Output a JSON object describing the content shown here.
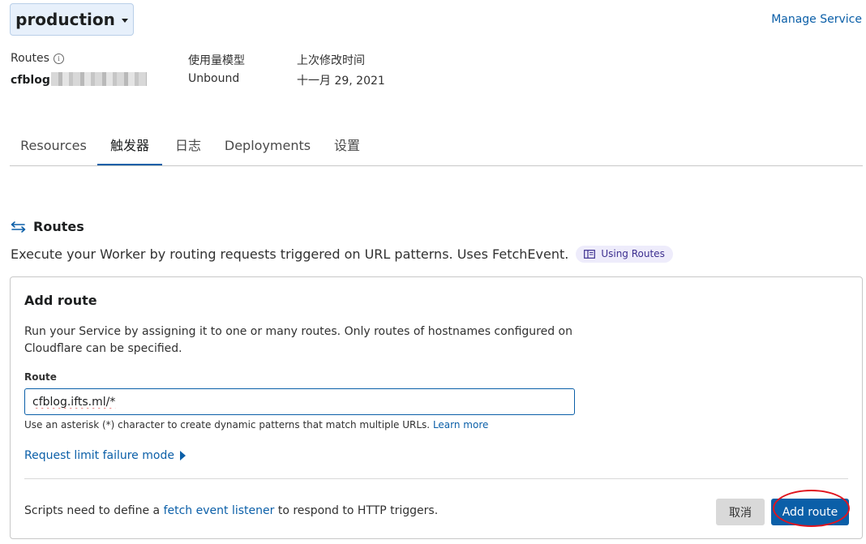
{
  "header": {
    "environment": "production",
    "manage_link": "Manage Service"
  },
  "meta": {
    "routes_label": "Routes",
    "routes_value": "cfblog",
    "usage_label": "使用量模型",
    "usage_value": "Unbound",
    "modified_label": "上次修改时间",
    "modified_value": "十一月 29, 2021"
  },
  "tabs": [
    {
      "label": "Resources"
    },
    {
      "label": "触发器",
      "active": true
    },
    {
      "label": "日志"
    },
    {
      "label": "Deployments"
    },
    {
      "label": "设置"
    }
  ],
  "routes_section": {
    "title": "Routes",
    "description": "Execute your Worker by routing requests triggered on URL patterns. Uses FetchEvent.",
    "doc_link": "Using Routes"
  },
  "add_route": {
    "title": "Add route",
    "description": "Run your Service by assigning it to one or many routes. Only routes of hostnames configured on Cloudflare can be specified.",
    "field_label": "Route",
    "input_value": "cfblog.ifts.ml/*",
    "hint": "Use an asterisk (*) character to create dynamic patterns that match multiple URLs.",
    "hint_link": "Learn more",
    "limit_toggle": "Request limit failure mode",
    "footer_prefix": "Scripts need to define a",
    "footer_link": "fetch event listener",
    "footer_suffix": "to respond to HTTP triggers.",
    "cancel_label": "取消",
    "submit_label": "Add route"
  },
  "colors": {
    "accent": "#0b5fa8",
    "env_bg": "#e7f0fb",
    "badge_bg": "#eeecfb",
    "annotation": "#e0141e"
  }
}
